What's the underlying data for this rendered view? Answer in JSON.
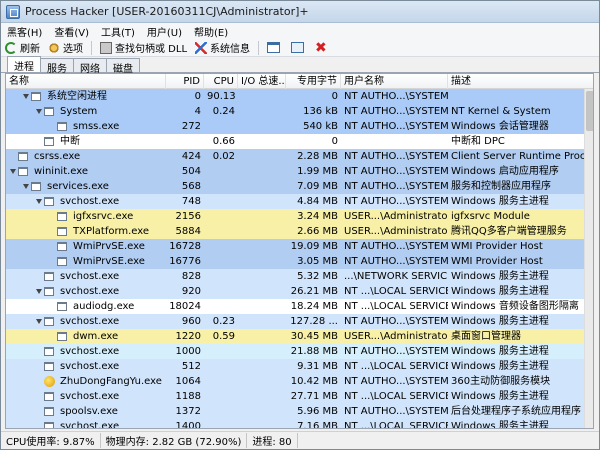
{
  "window": {
    "title": "Process Hacker [USER-20160311CJ\\Administrator]+"
  },
  "menu": [
    "黑客(H)",
    "查看(V)",
    "工具(T)",
    "用户(U)",
    "帮助(E)"
  ],
  "toolbar": {
    "refresh": "刷新",
    "options": "选项",
    "find": "查找句柄或 DLL",
    "sysinfo": "系统信息"
  },
  "tabs": [
    "进程",
    "服务",
    "网络",
    "磁盘"
  ],
  "columns": [
    "名称",
    "PID",
    "CPU",
    "I/O 总速...",
    "专用字节",
    "用户名称",
    "描述"
  ],
  "colors": {
    "system": "#aacbf7",
    "service": "#d0e4fc",
    "own": "#f7f0a6",
    "blue": "#b1cdf2",
    "white": "#ffffff",
    "light": "#d5effc"
  },
  "processes": [
    {
      "indent": 1,
      "expand": true,
      "icon": "window",
      "name": "系统空闲进程",
      "pid": "0",
      "cpu": "90.13",
      "io": "",
      "mem": "0",
      "user": "NT AUTHO...\\SYSTEM",
      "desc": "",
      "color": "system"
    },
    {
      "indent": 2,
      "expand": true,
      "icon": "window",
      "name": "System",
      "pid": "4",
      "cpu": "0.24",
      "io": "",
      "mem": "136 kB",
      "user": "NT AUTHO...\\SYSTEM",
      "desc": "NT Kernel & System",
      "color": "system"
    },
    {
      "indent": 3,
      "expand": false,
      "icon": "window",
      "name": "smss.exe",
      "pid": "272",
      "cpu": "",
      "io": "",
      "mem": "540 kB",
      "user": "NT AUTHO...\\SYSTEM",
      "desc": "Windows 会话管理器",
      "color": "system"
    },
    {
      "indent": 2,
      "expand": false,
      "icon": "window",
      "name": "中断",
      "pid": "",
      "cpu": "0.66",
      "io": "",
      "mem": "0",
      "user": "",
      "desc": "中断和 DPC",
      "color": "white"
    },
    {
      "indent": 0,
      "expand": false,
      "icon": "window",
      "name": "csrss.exe",
      "pid": "424",
      "cpu": "0.02",
      "io": "",
      "mem": "2.28 MB",
      "user": "NT AUTHO...\\SYSTEM",
      "desc": "Client Server Runtime Proce...",
      "color": "blue"
    },
    {
      "indent": 0,
      "expand": true,
      "icon": "window",
      "name": "wininit.exe",
      "pid": "504",
      "cpu": "",
      "io": "",
      "mem": "1.99 MB",
      "user": "NT AUTHO...\\SYSTEM",
      "desc": "Windows 启动应用程序",
      "color": "blue"
    },
    {
      "indent": 1,
      "expand": true,
      "icon": "window",
      "name": "services.exe",
      "pid": "568",
      "cpu": "",
      "io": "",
      "mem": "7.09 MB",
      "user": "NT AUTHO...\\SYSTEM",
      "desc": "服务和控制器应用程序",
      "color": "blue"
    },
    {
      "indent": 2,
      "expand": true,
      "icon": "window",
      "name": "svchost.exe",
      "pid": "748",
      "cpu": "",
      "io": "",
      "mem": "4.84 MB",
      "user": "NT AUTHO...\\SYSTEM",
      "desc": "Windows 服务主进程",
      "color": "service"
    },
    {
      "indent": 3,
      "expand": false,
      "icon": "window",
      "name": "igfxsrvc.exe",
      "pid": "2156",
      "cpu": "",
      "io": "",
      "mem": "3.24 MB",
      "user": "USER...\\Administrator",
      "desc": "igfxsrvc Module",
      "color": "own"
    },
    {
      "indent": 3,
      "expand": false,
      "icon": "window",
      "name": "TXPlatform.exe",
      "pid": "5884",
      "cpu": "",
      "io": "",
      "mem": "2.66 MB",
      "user": "USER...\\Administrator",
      "desc": "腾讯QQ多客户端管理服务",
      "color": "own"
    },
    {
      "indent": 3,
      "expand": false,
      "icon": "window",
      "name": "WmiPrvSE.exe",
      "pid": "16728",
      "cpu": "",
      "io": "",
      "mem": "19.09 MB",
      "user": "NT AUTHO...\\SYSTEM",
      "desc": "WMI Provider Host",
      "color": "blue"
    },
    {
      "indent": 3,
      "expand": false,
      "icon": "window",
      "name": "WmiPrvSE.exe",
      "pid": "16776",
      "cpu": "",
      "io": "",
      "mem": "3.05 MB",
      "user": "NT AUTHO...\\SYSTEM",
      "desc": "WMI Provider Host",
      "color": "blue"
    },
    {
      "indent": 2,
      "expand": false,
      "icon": "window",
      "name": "svchost.exe",
      "pid": "828",
      "cpu": "",
      "io": "",
      "mem": "5.32 MB",
      "user": "...\\NETWORK SERVICE",
      "desc": "Windows 服务主进程",
      "color": "service"
    },
    {
      "indent": 2,
      "expand": true,
      "icon": "window",
      "name": "svchost.exe",
      "pid": "920",
      "cpu": "",
      "io": "",
      "mem": "26.21 MB",
      "user": "NT ...\\LOCAL SERVICE",
      "desc": "Windows 服务主进程",
      "color": "service"
    },
    {
      "indent": 3,
      "expand": false,
      "icon": "window",
      "name": "audiodg.exe",
      "pid": "18024",
      "cpu": "",
      "io": "",
      "mem": "18.24 MB",
      "user": "NT ...\\LOCAL SERVICE",
      "desc": "Windows 音频设备图形隔离",
      "color": "white"
    },
    {
      "indent": 2,
      "expand": true,
      "icon": "window",
      "name": "svchost.exe",
      "pid": "960",
      "cpu": "0.23",
      "io": "",
      "mem": "127.28 ...",
      "user": "NT AUTHO...\\SYSTEM",
      "desc": "Windows 服务主进程",
      "color": "service"
    },
    {
      "indent": 3,
      "expand": false,
      "icon": "window",
      "name": "dwm.exe",
      "pid": "1220",
      "cpu": "0.59",
      "io": "",
      "mem": "30.45 MB",
      "user": "USER...\\Administrator",
      "desc": "桌面窗口管理器",
      "color": "own"
    },
    {
      "indent": 2,
      "expand": false,
      "icon": "window",
      "name": "svchost.exe",
      "pid": "1000",
      "cpu": "",
      "io": "",
      "mem": "21.88 MB",
      "user": "NT AUTHO...\\SYSTEM",
      "desc": "Windows 服务主进程",
      "color": "light"
    },
    {
      "indent": 2,
      "expand": false,
      "icon": "window",
      "name": "svchost.exe",
      "pid": "512",
      "cpu": "",
      "io": "",
      "mem": "9.31 MB",
      "user": "NT ...\\LOCAL SERVICE",
      "desc": "Windows 服务主进程",
      "color": "service"
    },
    {
      "indent": 2,
      "expand": false,
      "icon": "yellow",
      "name": "ZhuDongFangYu.exe",
      "pid": "1064",
      "cpu": "",
      "io": "",
      "mem": "10.42 MB",
      "user": "NT AUTHO...\\SYSTEM",
      "desc": "360主动防御服务模块",
      "color": "service"
    },
    {
      "indent": 2,
      "expand": false,
      "icon": "window",
      "name": "svchost.exe",
      "pid": "1188",
      "cpu": "",
      "io": "",
      "mem": "27.71 MB",
      "user": "NT ...\\LOCAL SERVICE",
      "desc": "Windows 服务主进程",
      "color": "service"
    },
    {
      "indent": 2,
      "expand": false,
      "icon": "window",
      "name": "spoolsv.exe",
      "pid": "1372",
      "cpu": "",
      "io": "",
      "mem": "5.96 MB",
      "user": "NT AUTHO...\\SYSTEM",
      "desc": "后台处理程序子系统应用程序",
      "color": "service"
    },
    {
      "indent": 2,
      "expand": false,
      "icon": "window",
      "name": "svchost.exe",
      "pid": "1400",
      "cpu": "",
      "io": "",
      "mem": "7.16 MB",
      "user": "NT ...\\LOCAL SERVICE",
      "desc": "Windows 服务主进程",
      "color": "service"
    }
  ],
  "status": {
    "cpu": "CPU使用率: 9.87%",
    "mem": "物理内存: 2.82 GB (72.90%)",
    "procs": "进程: 80"
  }
}
